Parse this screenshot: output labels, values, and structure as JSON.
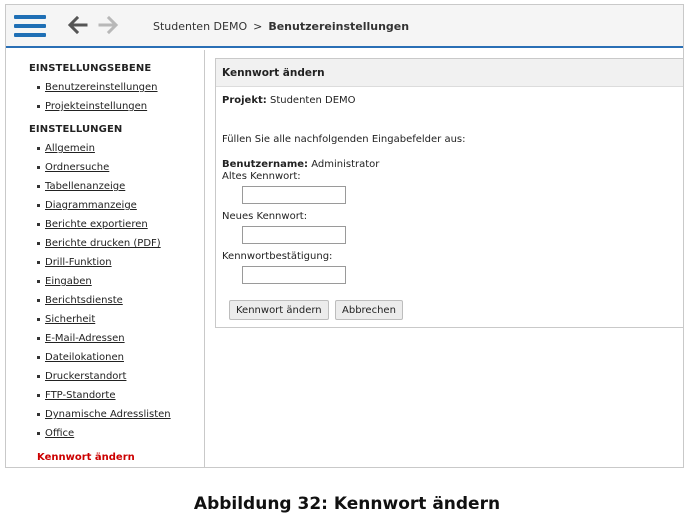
{
  "topbar": {
    "menu_icon": "hamburger-menu-icon",
    "back_icon": "arrow-left-icon",
    "forward_icon": "arrow-right-icon",
    "breadcrumb": {
      "project": "Studenten DEMO",
      "separator": ">",
      "current": "Benutzereinstellungen"
    },
    "accent_color": "#1f6fb5"
  },
  "sidebar": {
    "section1_heading": "EINSTELLUNGSEBENE",
    "section1_items": [
      "Benutzereinstellungen",
      "Projekteinstellungen"
    ],
    "section2_heading": "EINSTELLUNGEN",
    "section2_items": [
      "Allgemein",
      "Ordnersuche",
      "Tabellenanzeige",
      "Diagrammanzeige",
      "Berichte exportieren",
      "Berichte drucken (PDF)",
      "Drill-Funktion",
      "Eingaben",
      "Berichtsdienste",
      "Sicherheit",
      "E-Mail-Adressen",
      "Dateilokationen",
      "Druckerstandort",
      "FTP-Standorte",
      "Dynamische Adresslisten",
      "Office"
    ],
    "active_item": "Kennwort ändern",
    "active_color": "#cc0000"
  },
  "panel": {
    "title": "Kennwort ändern",
    "project_label": "Projekt:",
    "project_value": "Studenten DEMO",
    "instruction": "Füllen Sie alle nachfolgenden Eingabefelder aus:",
    "username_label": "Benutzername:",
    "username_value": "Administrator",
    "old_password_label": "Altes Kennwort:",
    "old_password_value": "",
    "new_password_label": "Neues Kennwort:",
    "new_password_value": "",
    "confirm_label": "Kennwortbestätigung:",
    "confirm_value": "",
    "submit_label": "Kennwort ändern",
    "cancel_label": "Abbrechen"
  },
  "caption": "Abbildung 32: Kennwort ändern"
}
